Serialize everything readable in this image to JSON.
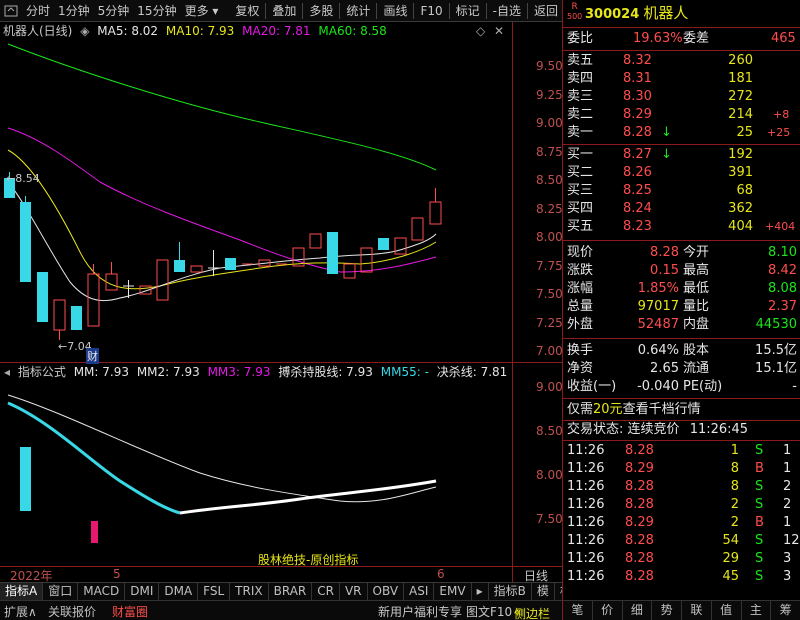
{
  "toolbar": {
    "periods": [
      "分时",
      "1分钟",
      "5分钟",
      "15分钟",
      "更多"
    ],
    "actions": [
      "复权",
      "叠加",
      "多股",
      "统计",
      "画线",
      "F10",
      "标记",
      "-自选",
      "返回"
    ]
  },
  "chart": {
    "title": "机器人(日线)",
    "ma": [
      {
        "label": "MA5: 8.02",
        "color": "#e6e6e6"
      },
      {
        "label": "MA10: 7.93",
        "color": "#e6e619"
      },
      {
        "label": "MA20: 7.81",
        "color": "#e619e6"
      },
      {
        "label": "MA60: 8.58",
        "color": "#19e619"
      }
    ],
    "y_ticks": [
      "9.50",
      "9.25",
      "9.00",
      "8.75",
      "8.50",
      "8.25",
      "8.00",
      "7.75",
      "7.50",
      "7.25",
      "7.00"
    ],
    "high_label": "8.54",
    "low_label": "7.04",
    "cai_label": "财"
  },
  "indicator": {
    "name": "指标公式",
    "values": [
      {
        "label": "MM: 7.93",
        "color": "#e6e6e6"
      },
      {
        "label": "MM2: 7.93",
        "color": "#e6e6e6"
      },
      {
        "label": "MM3: 7.93",
        "color": "#e619e6"
      },
      {
        "label": "搏杀持股线: 7.93",
        "color": "#e6e6e6"
      },
      {
        "label": "MM55: -",
        "color": "#39d8e6"
      },
      {
        "label": "决杀线: 7.81",
        "color": "#e6e6e6"
      }
    ],
    "y_ticks": [
      "9.00",
      "8.50",
      "8.00",
      "7.50"
    ],
    "footer": "股林绝技-原创指标"
  },
  "xaxis": {
    "year": "2022年",
    "m5": "5",
    "m6": "6",
    "period": "日线"
  },
  "bottom_tabs": [
    "指标A",
    "窗口",
    "MACD",
    "DMI",
    "DMA",
    "FSL",
    "TRIX",
    "BRAR",
    "CR",
    "VR",
    "OBV",
    "ASI",
    "EMV",
    "指标B",
    "模",
    "板"
  ],
  "status": {
    "expand": "扩展∧",
    "reference": "关联报价",
    "fortune": "财富圈",
    "promo": "新用户福利专享",
    "f10": "图文F10",
    "sidebar": "侧边栏"
  },
  "quote": {
    "r_mark": "R",
    "r_sub": "500",
    "code": "300024",
    "name": "机器人",
    "weibi_label": "委比",
    "weibi": "19.63%",
    "weicha_label": "委差",
    "weicha": "465",
    "asks": [
      {
        "label": "卖五",
        "price": "8.32",
        "vol": "260",
        "delta": ""
      },
      {
        "label": "卖四",
        "price": "8.31",
        "vol": "181",
        "delta": ""
      },
      {
        "label": "卖三",
        "price": "8.30",
        "vol": "272",
        "delta": ""
      },
      {
        "label": "卖二",
        "price": "8.29",
        "vol": "214",
        "delta": "+8"
      },
      {
        "label": "卖一",
        "price": "8.28",
        "vol": "25",
        "delta": "+25",
        "arrow": "↓"
      }
    ],
    "bids": [
      {
        "label": "买一",
        "price": "8.27",
        "vol": "192",
        "delta": "",
        "arrow": "↓"
      },
      {
        "label": "买二",
        "price": "8.26",
        "vol": "391",
        "delta": ""
      },
      {
        "label": "买三",
        "price": "8.25",
        "vol": "68",
        "delta": ""
      },
      {
        "label": "买四",
        "price": "8.24",
        "vol": "362",
        "delta": ""
      },
      {
        "label": "买五",
        "price": "8.23",
        "vol": "404",
        "delta": "+404"
      }
    ],
    "stats": [
      {
        "l1": "现价",
        "v1": "8.28",
        "c1": "red",
        "l2": "今开",
        "v2": "8.10",
        "c2": "green"
      },
      {
        "l1": "涨跌",
        "v1": "0.15",
        "c1": "red",
        "l2": "最高",
        "v2": "8.42",
        "c2": "red"
      },
      {
        "l1": "涨幅",
        "v1": "1.85%",
        "c1": "red",
        "l2": "最低",
        "v2": "8.08",
        "c2": "green"
      },
      {
        "l1": "总量",
        "v1": "97017",
        "c1": "yellow",
        "l2": "量比",
        "v2": "2.37",
        "c2": "red"
      },
      {
        "l1": "外盘",
        "v1": "52487",
        "c1": "red",
        "l2": "内盘",
        "v2": "44530",
        "c2": "green"
      }
    ],
    "stats2": [
      {
        "l1": "换手",
        "v1": "0.64%",
        "l2": "股本",
        "v2": "15.5亿"
      },
      {
        "l1": "净资",
        "v1": "2.65",
        "l2": "流通",
        "v2": "15.1亿"
      },
      {
        "l1": "收益(一)",
        "v1": "-0.040",
        "l2": "PE(动)",
        "v2": "-"
      }
    ],
    "promo_prefix": "仅需",
    "promo_price": "20元",
    "promo_suffix": "查看千档行情",
    "trade_state_label": "交易状态:",
    "trade_state": "连续竞价",
    "trade_time": "11:26:45",
    "ticks": [
      {
        "time": "11:26",
        "price": "8.28",
        "vol": "1",
        "bs": "S",
        "extra": "1"
      },
      {
        "time": "11:26",
        "price": "8.29",
        "vol": "8",
        "bs": "B",
        "extra": "1"
      },
      {
        "time": "11:26",
        "price": "8.28",
        "vol": "8",
        "bs": "S",
        "extra": "2"
      },
      {
        "time": "11:26",
        "price": "8.28",
        "vol": "2",
        "bs": "S",
        "extra": "2"
      },
      {
        "time": "11:26",
        "price": "8.29",
        "vol": "2",
        "bs": "B",
        "extra": "1"
      },
      {
        "time": "11:26",
        "price": "8.28",
        "vol": "54",
        "bs": "S",
        "extra": "12"
      },
      {
        "time": "11:26",
        "price": "8.28",
        "vol": "29",
        "bs": "S",
        "extra": "3"
      },
      {
        "time": "11:26",
        "price": "8.28",
        "vol": "45",
        "bs": "S",
        "extra": "3"
      }
    ],
    "nav": [
      "笔",
      "价",
      "细",
      "势",
      "联",
      "值",
      "主",
      "筹"
    ]
  }
}
